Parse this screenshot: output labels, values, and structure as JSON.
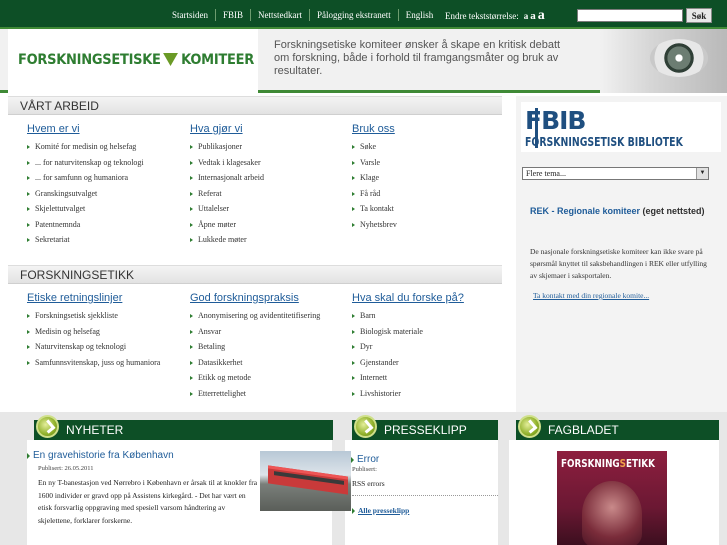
{
  "topnav": {
    "items": [
      "Startsiden",
      "FBIB",
      "Nettstedkart",
      "Pålogging ekstranett",
      "English"
    ],
    "text_size_label": "Endre tekststørrelse:",
    "text_size_options": [
      "a",
      "a",
      "a"
    ],
    "search_value": "",
    "search_button": "Søk"
  },
  "header": {
    "logo": "FORSKNINGSETISKE KOMITEER",
    "logo_left": "FORSKNINGSETISKE",
    "logo_right": "KOMITEER",
    "tagline": "Forskningsetiske komiteer ønsker å skape en kritisk debatt om forskning, både i forhold til framgangsmåter og bruk av resultater."
  },
  "vart_arbeid": {
    "title": "VÅRT ARBEID",
    "columns": [
      {
        "heading": "Hvem er vi",
        "items": [
          "Komité for medisin og helsefag",
          "... for naturvitenskap og teknologi",
          "... for samfunn og humaniora",
          "Granskingsutvalget",
          "Skjelettutvalget",
          "Patentnemnda",
          "Sekretariat"
        ]
      },
      {
        "heading": "Hva gjør vi",
        "items": [
          "Publikasjoner",
          "Vedtak i klagesaker",
          "Internasjonalt arbeid",
          "Referat",
          "Uttalelser",
          "Åpne møter",
          "Lukkede møter"
        ]
      },
      {
        "heading": "Bruk oss",
        "items": [
          "Søke",
          "Varsle",
          "Klage",
          "Få råd",
          "Ta kontakt",
          "Nyhetsbrev"
        ]
      }
    ]
  },
  "forskningsetikk": {
    "title": "FORSKNINGSETIKK",
    "columns": [
      {
        "heading": "Etiske retningslinjer",
        "items": [
          "Forskningsetisk sjekkliste",
          "Medisin og helsefag",
          "Naturvitenskap og teknologi",
          "Samfunnsvitenskap, juss og humaniora"
        ]
      },
      {
        "heading": "God forskningspraksis",
        "items": [
          "Anonymisering og avidentitetifisering",
          "Ansvar",
          "Betaling",
          "Datasikkerhet",
          "Etikk og metode",
          "Etterrettelighet"
        ]
      },
      {
        "heading": "Hva skal du forske på?",
        "items": [
          "Barn",
          "Biologisk materiale",
          "Dyr",
          "Gjenstander",
          "Internett",
          "Livshistorier"
        ]
      }
    ]
  },
  "sidebar": {
    "fbib_top": "FBIB",
    "fbib_bottom": "FORSKNINGSETISK BIBLIOTEK",
    "select_value": "Flere tema...",
    "rek_title_link": "REK - Regionale komiteer",
    "rek_title_rest": "(eget nettsted)",
    "rek_text": "De nasjonale forskningsetiske komiteer kan ikke svare på spørsmål knyttet til saksbehandlingen i REK eller utfylling av skjemaer i saksportalen.",
    "rek_link": "Ta kontakt med din regionale komite..."
  },
  "nyheter": {
    "heading": "NYHETER",
    "title": "En gravehistorie fra København",
    "date": "Publisert: 26.05.2011",
    "body": "En ny T-banestasjon ved Nørrebro i København er årsak til at knokler fra 1600 individer er gravd opp på Assistens kirkegård. - Det har vært en etisk forsvarlig oppgraving med spesiell varsom håndtering av skjelettene, forklarer forskerne."
  },
  "presseklipp": {
    "heading": "PRESSEKLIPP",
    "title": "Error",
    "label": "Publisert:",
    "errors": "RSS errors",
    "all_link": "Alle presseklipp"
  },
  "fagbladet": {
    "heading": "FAGBLADET",
    "magazine_a": "FORSKNING",
    "magazine_b": "S",
    "magazine_c": "ETIKK"
  }
}
